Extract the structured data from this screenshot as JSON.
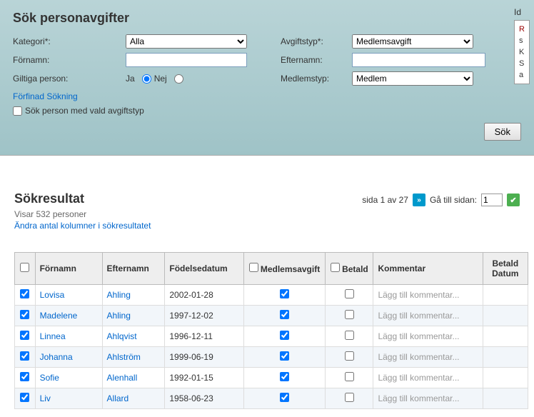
{
  "search": {
    "title": "Sök personavgifter",
    "labels": {
      "kategori": "Kategori*:",
      "fornamn": "Förnamn:",
      "giltiga": "Giltiga person:",
      "avgiftstyp": "Avgiftstyp*:",
      "efternamn": "Efternamn:",
      "medlemstyp": "Medlemstyp:",
      "ja": "Ja",
      "nej": "Nej",
      "refined": "Förfinad Sökning",
      "checkbox": "Sök person med vald avgiftstyp",
      "sok_btn": "Sök",
      "id": "Id"
    },
    "values": {
      "kategori": "Alla",
      "avgiftstyp": "Medlemsavgift",
      "medlemstyp": "Medlem",
      "fornamn": "",
      "efternamn": ""
    },
    "sidebar": {
      "r": "R",
      "s": "s",
      "k": "K",
      "ss": "S",
      "a": "a"
    }
  },
  "results": {
    "title": "Sökresultat",
    "pager": {
      "sida_text": "sida 1 av 27",
      "goto_label": "Gå till sidan:",
      "goto_value": "1"
    },
    "count_text": "Visar 532 personer",
    "columns_link": "Ändra antal kolumner i sökresultatet",
    "headers": {
      "fornamn": "Förnamn",
      "efternamn": "Efternamn",
      "fodelsedatum": "Födelsedatum",
      "medlemsavgift": "Medlemsavgift",
      "betald": "Betald",
      "kommentar": "Kommentar",
      "betald_datum": "Betald Datum"
    },
    "comment_ph": "Lägg till kommentar...",
    "rows": [
      {
        "sel": true,
        "fn": "Lovisa",
        "en": "Ahling",
        "fd": "2002-01-28",
        "ma": true,
        "bt": false
      },
      {
        "sel": true,
        "fn": "Madelene",
        "en": "Ahling",
        "fd": "1997-12-02",
        "ma": true,
        "bt": false
      },
      {
        "sel": true,
        "fn": "Linnea",
        "en": "Ahlqvist",
        "fd": "1996-12-11",
        "ma": true,
        "bt": false
      },
      {
        "sel": true,
        "fn": "Johanna",
        "en": "Ahlström",
        "fd": "1999-06-19",
        "ma": true,
        "bt": false
      },
      {
        "sel": true,
        "fn": "Sofie",
        "en": "Alenhall",
        "fd": "1992-01-15",
        "ma": true,
        "bt": false
      },
      {
        "sel": true,
        "fn": "Liv",
        "en": "Allard",
        "fd": "1958-06-23",
        "ma": true,
        "bt": false
      }
    ]
  }
}
